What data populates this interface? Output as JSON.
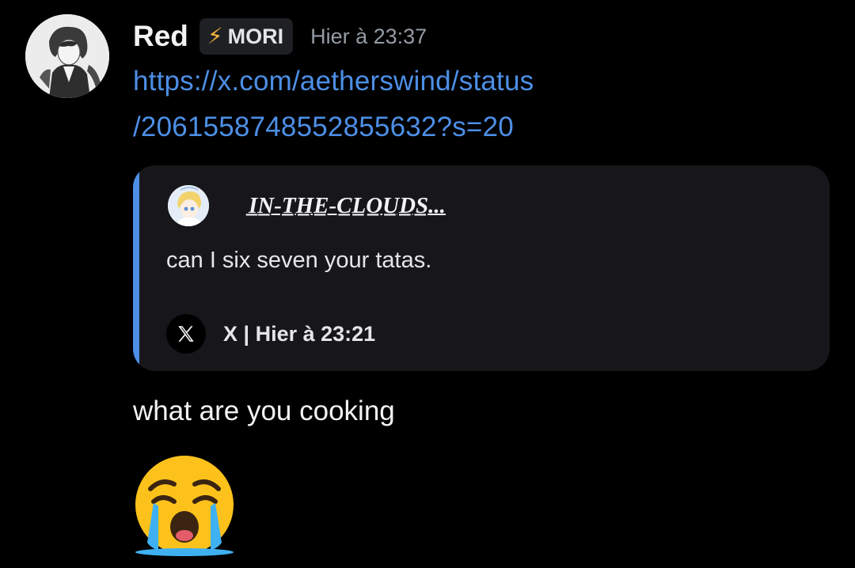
{
  "message": {
    "author": {
      "username": "Red",
      "tag": "MORI",
      "tag_icon": "lightning-bolt-icon",
      "timestamp": "Hier à 23:37"
    },
    "link": {
      "line1": "https://x.com/aetherswind/status",
      "line2": "/2061558748552855632?s=20"
    },
    "embed": {
      "author_name": "I̲N̲-T̲H̲E̲-C̲L̲O̲U̲D̲S̲...",
      "description": "can I six seven your tatas.",
      "footer_icon": "x-logo-icon",
      "footer_text": "X | Hier à 23:21",
      "accent_color": "#4d8fe6"
    },
    "text": "what are you cooking",
    "emoji": "loudly-crying-face-emoji"
  },
  "colors": {
    "background": "#000000",
    "link": "#4d8fe6",
    "embed_background": "#17171b",
    "timestamp": "#949ba4",
    "tag_background": "#1f2024"
  }
}
